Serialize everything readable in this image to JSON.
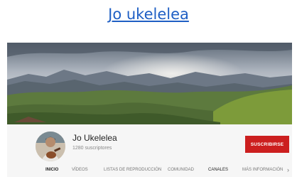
{
  "link": {
    "title": "Jo ukelelea"
  },
  "channel": {
    "name": "Jo Ukelelea",
    "subscribers": "1280 suscriptores",
    "subscribe_label": "SUSCRIBIRSE"
  },
  "tabs": [
    {
      "label": "INICIO"
    },
    {
      "label": "VÍDEOS"
    },
    {
      "label": "LISTAS DE REPRODUCCIÓN"
    },
    {
      "label": "COMUNIDAD"
    },
    {
      "label": "CANALES"
    },
    {
      "label": "MÁS INFORMACIÓN"
    }
  ],
  "colors": {
    "link": "#1f5fc4",
    "subscribe": "#cc1f1f"
  }
}
